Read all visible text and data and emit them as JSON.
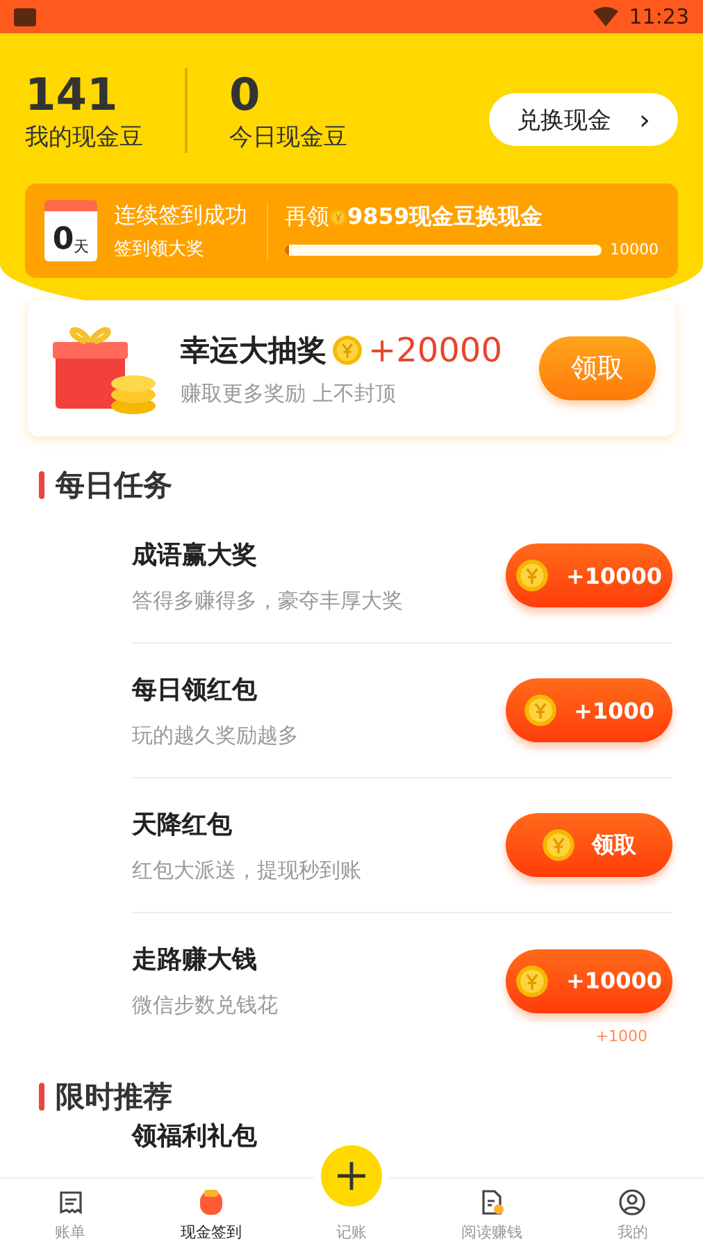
{
  "status_bar": {
    "time": "11:23"
  },
  "summary": {
    "stats": [
      {
        "value": "141",
        "label": "我的现金豆"
      },
      {
        "value": "0",
        "label": "今日现金豆"
      }
    ],
    "exchange_button": "兑换现金",
    "exchange_arrow": "›"
  },
  "checkin": {
    "days": "0",
    "days_unit": "天",
    "title": "连续签到成功",
    "subtitle": "签到领大奖",
    "goal_prefix": "再领",
    "goal_text": "9859现金豆换现金",
    "level": 0.014,
    "target": "10000"
  },
  "lottery": {
    "title": "幸运大抽奖",
    "reward": "+20000",
    "subtitle": "赚取更多奖励 上不封顶",
    "button": "领取"
  },
  "daily_tasks": {
    "title": "每日任务",
    "items": [
      {
        "title": "成语赢大奖",
        "subtitle": "答得多赚得多，豪夺丰厚大奖",
        "button": "+10000"
      },
      {
        "title": "每日领红包",
        "subtitle": "玩的越久奖励越多",
        "button": "+1000"
      },
      {
        "title": "天降红包",
        "subtitle": "红包大派送，提现秒到账",
        "button": "领取"
      },
      {
        "title": "走路赚大钱",
        "subtitle": "微信步数兑钱花",
        "button": "+10000",
        "note": "+1000"
      }
    ]
  },
  "recommend": {
    "title": "限时推荐",
    "items": [
      {
        "title": "领福利礼包"
      }
    ]
  },
  "tab_bar": [
    {
      "label": "账单",
      "kind": "bill",
      "selected": false
    },
    {
      "label": "现金签到",
      "kind": "redpacket",
      "selected": true
    },
    {
      "label": "记账",
      "kind": "add",
      "selected": false
    },
    {
      "label": "阅读赚钱",
      "kind": "read",
      "selected": false
    },
    {
      "label": "我的",
      "kind": "profile",
      "selected": false
    }
  ]
}
